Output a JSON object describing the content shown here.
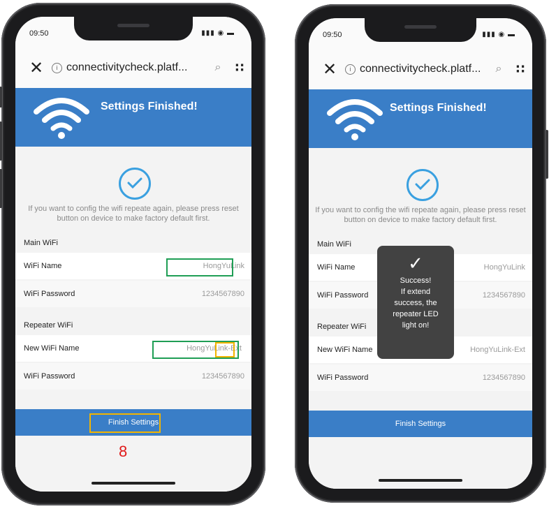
{
  "colors": {
    "banner": "#3a7ec7",
    "check": "#3aa0e0",
    "highlight_green": "#1f9e55",
    "highlight_yellow": "#f2b400",
    "step": "#e01a1a"
  },
  "left_phone": {
    "status_time": "09:50",
    "status_icons": "signal wifi battery",
    "url_text": "connectivitycheck.platf...",
    "banner_title": "Settings Finished!",
    "note": "If you want to config the wifi repeate again, please press reset button on device to make factory default first.",
    "main_wifi": {
      "heading": "Main WiFi",
      "name_label": "WiFi Name",
      "name_value": "HongYuLink",
      "password_label": "WiFi Password",
      "password_value": "1234567890"
    },
    "repeater_wifi": {
      "heading": "Repeater WiFi",
      "name_label": "New WiFi Name",
      "name_value": "HongYuLink-",
      "name_suffix": "Ext",
      "password_label": "WiFi Password",
      "password_value": "1234567890"
    },
    "finish_label": "Finish Settings",
    "step_number": "8"
  },
  "right_phone": {
    "status_time": "09:50",
    "url_text": "connectivitycheck.platf...",
    "banner_title": "Settings Finished!",
    "note": "If you want to config the wifi repeate again, please press reset button on device to make factory default first.",
    "main_wifi": {
      "heading": "Main WiFi",
      "name_label": "WiFi Name",
      "name_value": "HongYuLink",
      "password_label": "WiFi Password",
      "password_value": "1234567890"
    },
    "repeater_wifi": {
      "heading": "Repeater WiFi",
      "name_label": "New WiFi Name",
      "name_value": "HongYuLink-Ext",
      "password_label": "WiFi Password",
      "password_value": "1234567890"
    },
    "finish_label": "Finish Settings",
    "toast": {
      "line1": "Success!",
      "line2": "If extend",
      "line3": "success, the",
      "line4": "repeater LED",
      "line5": "light on!"
    }
  }
}
